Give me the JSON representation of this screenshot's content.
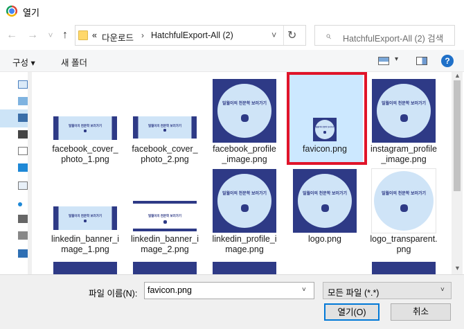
{
  "window": {
    "title": "열기"
  },
  "nav": {
    "back": "←",
    "forward": "→",
    "recent": "˅",
    "up": "↑"
  },
  "address": {
    "prefix": "«",
    "crumbs": [
      "다운로드",
      "HatchfulExport-All (2)"
    ],
    "separator": "›",
    "dropdown": "˅",
    "refresh": "↻"
  },
  "search": {
    "placeholder": "HatchfulExport-All (2) 검색"
  },
  "toolbar": {
    "organize": "구성 ▾",
    "new_folder": "새 폴더",
    "view_caret": "▾",
    "help": "?"
  },
  "files": [
    {
      "name": "facebook_cover_photo_1.png",
      "line1": "facebook_cover_",
      "line2": "photo_1.png",
      "shape": "cover"
    },
    {
      "name": "facebook_cover_photo_2.png",
      "line1": "facebook_cover_",
      "line2": "photo_2.png",
      "shape": "cover-sm"
    },
    {
      "name": "facebook_profile_image.png",
      "line1": "facebook_profile",
      "line2": "_image.png",
      "shape": "square"
    },
    {
      "name": "favicon.png",
      "line1": "favicon.png",
      "line2": "",
      "shape": "favicon"
    },
    {
      "name": "instagram_profile_image.png",
      "line1": "instagram_profile",
      "line2": "_image.png",
      "shape": "square"
    },
    {
      "name": "linkedin_banner_image_1.png",
      "line1": "linkedin_banner_i",
      "line2": "mage_1.png",
      "shape": "cover"
    },
    {
      "name": "linkedin_banner_image_2.png",
      "line1": "linkedin_banner_i",
      "line2": "mage_2.png",
      "shape": "banner-white"
    },
    {
      "name": "linkedin_profile_image.png",
      "line1": "linkedin_profile_i",
      "line2": "mage.png",
      "shape": "square"
    },
    {
      "name": "logo.png",
      "line1": "logo.png",
      "line2": "",
      "shape": "square"
    },
    {
      "name": "logo_transparent.png",
      "line1": "logo_transparent.",
      "line2": "png",
      "shape": "transparent"
    }
  ],
  "thumbnail_text": "밀월이의 천문학 보러가기",
  "footer": {
    "filename_label": "파일 이름(N):",
    "filename_value": "favicon.png",
    "filename_caret": "˅",
    "filter": "모든 파일 (*.*)",
    "filter_caret": "˅",
    "open": "열기(O)",
    "cancel": "취소"
  },
  "colors": {
    "highlight": "#e0142a",
    "thumb_bg": "#2e3a86",
    "circle": "#cfe4f7",
    "selected": "#cce8ff"
  }
}
